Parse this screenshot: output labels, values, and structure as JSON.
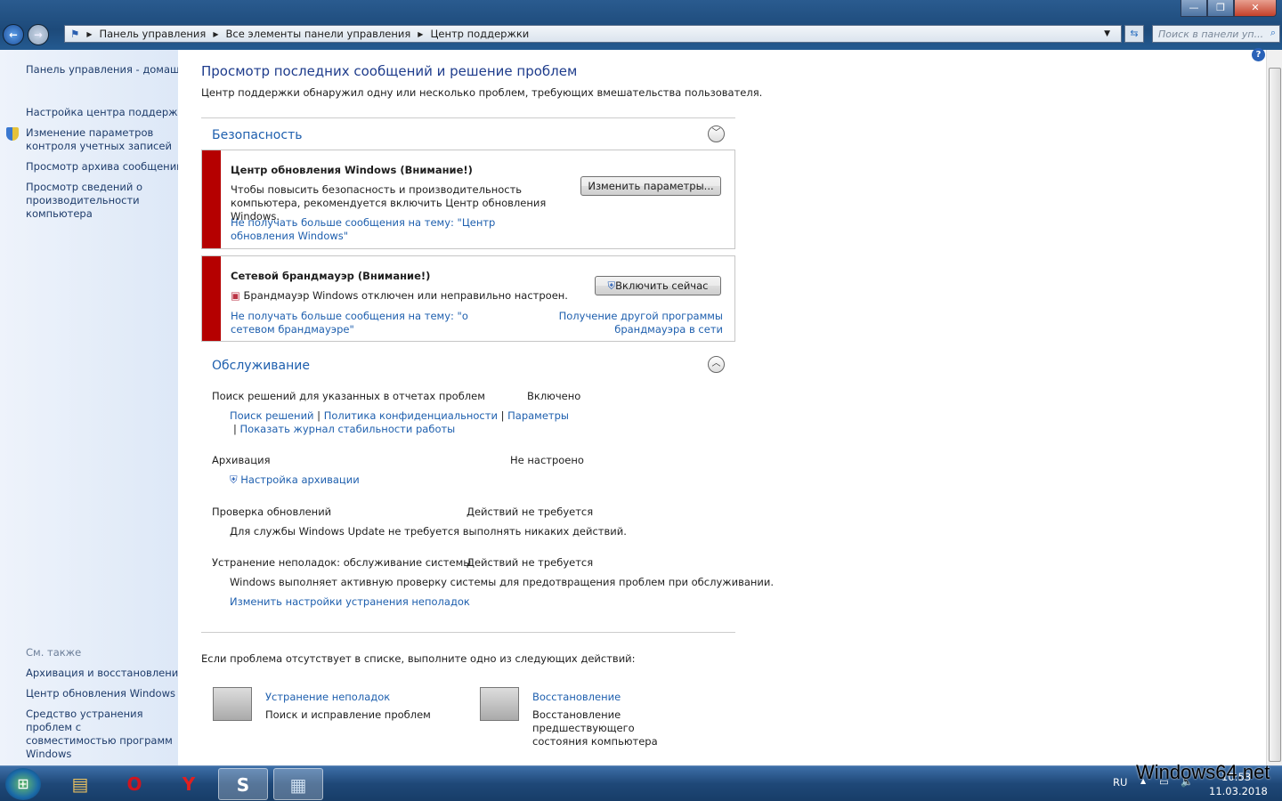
{
  "window": {
    "min": "—",
    "max": "❐",
    "close": "✕"
  },
  "breadcrumb": [
    "Панель управления",
    "Все элементы панели управления",
    "Центр поддержки"
  ],
  "search": {
    "placeholder": "Поиск в панели уп..."
  },
  "sidebar": {
    "links": [
      "Панель управления - домашняя страница",
      "Настройка центра поддержки",
      "Изменение параметров контроля учетных записей",
      "Просмотр архива сообщений",
      "Просмотр сведений о производительности компьютера"
    ],
    "see_also": "См. также",
    "see_also_links": [
      "Архивация и восстановление",
      "Центр обновления Windows",
      "Средство устранения проблем с совместимостью программ Windows"
    ]
  },
  "main": {
    "title": "Просмотр последних сообщений и решение проблем",
    "subtitle": "Центр поддержки обнаружил одну или несколько проблем, требующих вмешательства пользователя.",
    "security": {
      "title": "Безопасность",
      "alerts": [
        {
          "title": "Центр обновления Windows  (Внимание!)",
          "text": "Чтобы повысить безопасность и производительность компьютера, рекомендуется включить Центр обновления Windows.",
          "link": "Не получать больше сообщения на тему: \"Центр обновления Windows\"",
          "button": "Изменить параметры..."
        },
        {
          "title": "Сетевой брандмауэр  (Внимание!)",
          "text": "Брандмауэр Windows отключен или неправильно настроен.",
          "link": "Не получать больше сообщения на тему: \"о сетевом брандмауэре\"",
          "button": "Включить сейчас",
          "link2": "Получение другой программы брандмауэра в сети"
        }
      ]
    },
    "maintenance": {
      "title": "Обслуживание",
      "items": [
        {
          "label": "Поиск решений для указанных в отчетах проблем",
          "status": "Включено",
          "links": [
            "Поиск решений",
            "Политика конфиденциальности",
            "Параметры",
            "Показать журнал стабильности работы"
          ]
        },
        {
          "label": "Архивация",
          "status": "Не настроено",
          "link": "Настройка архивации"
        },
        {
          "label": "Проверка обновлений",
          "status": "Действий не требуется",
          "text": "Для службы Windows Update не требуется выполнять никаких действий."
        },
        {
          "label": "Устранение неполадок: обслуживание системы",
          "status": "Действий не требуется",
          "text": "Windows выполняет активную проверку системы для предотвращения проблем при обслуживании.",
          "link": "Изменить настройки устранения неполадок"
        }
      ]
    },
    "footer_text": "Если проблема отсутствует в списке, выполните одно из следующих действий:",
    "actions": [
      {
        "title": "Устранение неполадок",
        "desc": "Поиск и исправление проблем"
      },
      {
        "title": "Восстановление",
        "desc": "Восстановление предшествующего состояния компьютера"
      }
    ]
  },
  "taskbar": {
    "lang": "RU",
    "time": "10:53",
    "date": "11.03.2018",
    "watermark": "Windows64.net"
  }
}
